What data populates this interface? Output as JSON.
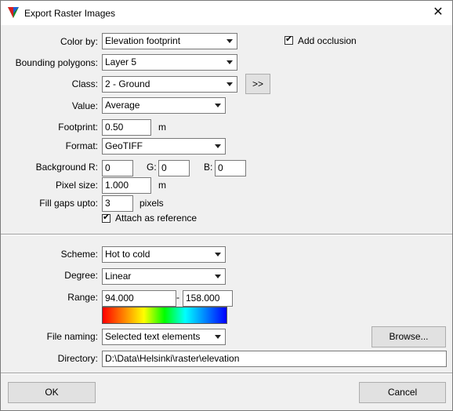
{
  "window": {
    "title": "Export Raster Images",
    "close_glyph": "✕"
  },
  "form": {
    "color_by": {
      "label": "Color by:",
      "value": "Elevation footprint"
    },
    "add_occlusion": {
      "label": "Add occlusion",
      "checked": true
    },
    "bounding_polygons": {
      "label": "Bounding polygons:",
      "value": "Layer 5"
    },
    "class": {
      "label": "Class:",
      "value": "2 - Ground",
      "button": ">>"
    },
    "value": {
      "label": "Value:",
      "value": "Average"
    },
    "footprint": {
      "label": "Footprint:",
      "value": "0.50",
      "unit": "m"
    },
    "format": {
      "label": "Format:",
      "value": "GeoTIFF"
    },
    "background": {
      "label": "Background R:",
      "r": "0",
      "g_label": "G:",
      "g": "0",
      "b_label": "B:",
      "b": "0"
    },
    "pixel_size": {
      "label": "Pixel size:",
      "value": "1.000",
      "unit": "m"
    },
    "fill_gaps": {
      "label": "Fill gaps upto:",
      "value": "3",
      "unit": "pixels"
    },
    "attach_reference": {
      "label": "Attach as reference",
      "checked": true
    }
  },
  "color_section": {
    "scheme": {
      "label": "Scheme:",
      "value": "Hot to cold"
    },
    "degree": {
      "label": "Degree:",
      "value": "Linear"
    },
    "range": {
      "label": "Range:",
      "min": "94.000",
      "dash": "-",
      "max": "158.000"
    },
    "gradient_colors": [
      "#ff0000",
      "#ff8000",
      "#ffff00",
      "#00ff00",
      "#00ffff",
      "#0080ff",
      "#0000ff"
    ],
    "file_naming": {
      "label": "File naming:",
      "value": "Selected text elements",
      "button": "Browse..."
    },
    "directory": {
      "label": "Directory:",
      "value": "D:\\Data\\Helsinki\\raster\\elevation"
    }
  },
  "footer": {
    "ok": "OK",
    "cancel": "Cancel"
  },
  "icons": {
    "app": "microstation-app-icon",
    "dropdown": "chevron-down-icon",
    "check": "checkmark-icon"
  }
}
